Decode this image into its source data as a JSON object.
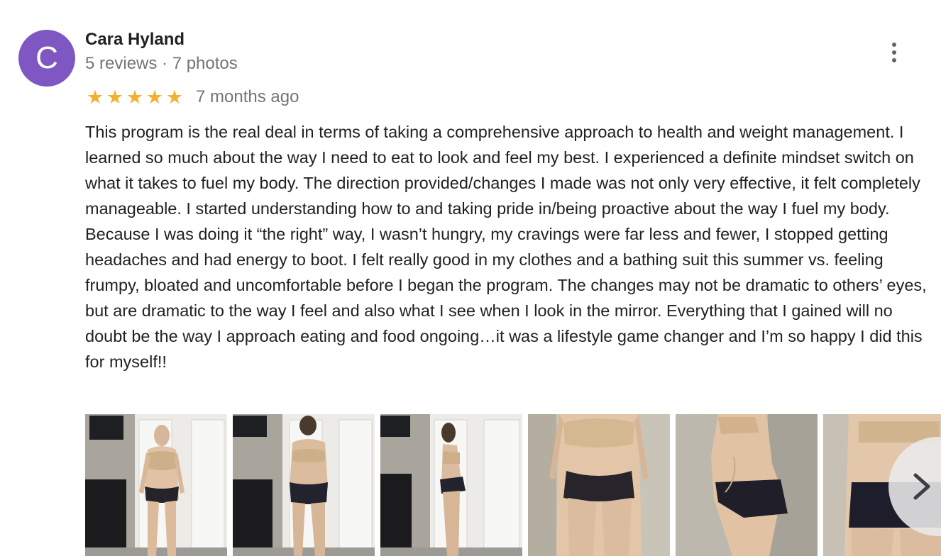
{
  "review": {
    "author": {
      "initial": "C",
      "name": "Cara Hyland",
      "meta": "5 reviews · 7 photos",
      "avatar_color": "#7e57c2"
    },
    "rating": {
      "stars": 5,
      "max_stars": 5,
      "star_color": "#f2b231"
    },
    "date": "7 months ago",
    "text": "This program is the real deal in terms of taking a comprehensive approach to health and weight management. I learned so much about the way I need to eat to look and feel my best. I experienced a definite mindset switch on what it takes to fuel my body. The direction provided/changes I made was not only very effective, it felt completely manageable. I started understanding how to and taking pride in/being proactive about the way I fuel my body. Because I was doing it “the right” way, I wasn’t hungry, my cravings were far less and fewer, I stopped getting headaches and had energy to boot. I felt really good in my clothes and a bathing suit this summer vs. feeling frumpy, bloated and uncomfortable before I began the program. The changes may not be dramatic to others’ eyes, but are dramatic to the way I feel and also what I see when I look in the mirror. Everything that I gained will no doubt be the way I approach eating and food ongoing…it was a lifestyle game changer and I’m so happy I did this for myself!!",
    "more_icon": "more-vert-icon",
    "next_icon": "chevron-right-icon",
    "photos_count_visible": 6
  }
}
